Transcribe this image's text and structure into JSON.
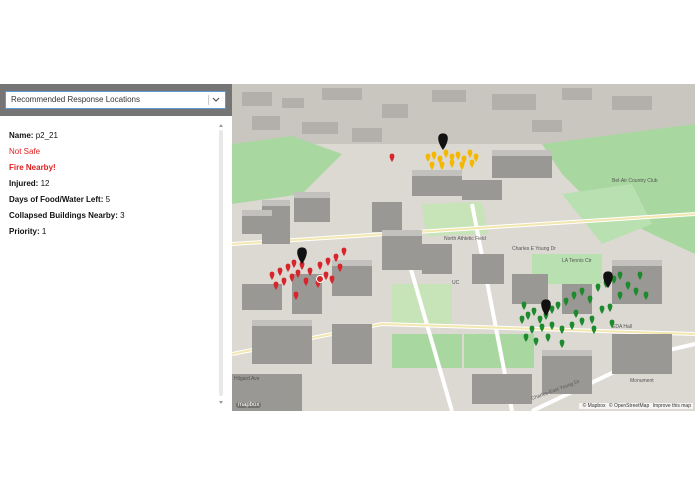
{
  "panel": {
    "dropdown_value": "Recommended Response Locations",
    "name_label": "Name:",
    "name_value": "p2_21",
    "status": "Not Safe",
    "fire": "Fire Nearby!",
    "injured_label": "Injured:",
    "injured_value": "12",
    "food_label": "Days of Food/Water Left:",
    "food_value": "5",
    "collapsed_label": "Collapsed Buildings Nearby:",
    "collapsed_value": "3",
    "priority_label": "Priority:",
    "priority_value": "1"
  },
  "map": {
    "labels": {
      "street_a": "Charles E Young Dr N",
      "street_b": "Charles E Young Dr",
      "street_c": "North Athletic Field",
      "street_d": "Ashe Center",
      "street_e": "Charles-East Young Dr",
      "street_f": "Hilgard Ave",
      "street_g": "Monument",
      "street_h": "Bel-Air Country Club",
      "street_i": "LA Tennis Ctr",
      "street_j": "EDA Hall",
      "street_k": "UC"
    },
    "attribution": {
      "mapbox": "© Mapbox",
      "osm": "© OpenStreetMap",
      "improve": "Improve this map"
    },
    "logo": "mapbox",
    "cluster_colors": {
      "red": "#d7262b",
      "yellow": "#f5b800",
      "green": "#1e8a2e",
      "black": "#111111"
    }
  }
}
